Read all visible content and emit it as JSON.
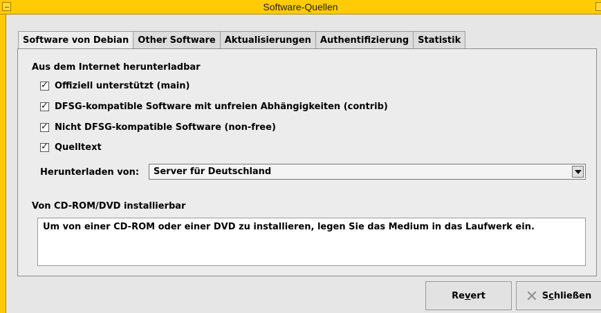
{
  "window": {
    "title": "Software-Quellen"
  },
  "tabs": [
    {
      "label": "Software von Debian",
      "active": true
    },
    {
      "label": "Other Software",
      "active": false
    },
    {
      "label": "Aktualisierungen",
      "active": false
    },
    {
      "label": "Authentifizierung",
      "active": false
    },
    {
      "label": "Statistik",
      "active": false
    }
  ],
  "internet_section": {
    "heading": "Aus dem Internet herunterladbar",
    "checkboxes": [
      {
        "label": "Offiziell unterstützt (main)",
        "checked": true
      },
      {
        "label": "DFSG-kompatible Software mit unfreien Abhängigkeiten (contrib)",
        "checked": true
      },
      {
        "label": "Nicht DFSG-kompatible Software (non-free)",
        "checked": true
      },
      {
        "label": "Quelltext",
        "checked": true
      }
    ],
    "download_from_label": "Herunterladen von:",
    "download_from_value": "Server für Deutschland"
  },
  "cd_section": {
    "heading": "Von CD-ROM/DVD installierbar",
    "text": "Um von einer CD-ROM oder einer DVD zu installieren, legen Sie das Medium in das Laufwerk ein."
  },
  "buttons": {
    "revert_pre": "Re",
    "revert_mnemonic": "v",
    "revert_post": "ert",
    "close_pre": "S",
    "close_mnemonic": "c",
    "close_post": "hließen"
  },
  "colors": {
    "titlebar": "#ffcb05"
  }
}
